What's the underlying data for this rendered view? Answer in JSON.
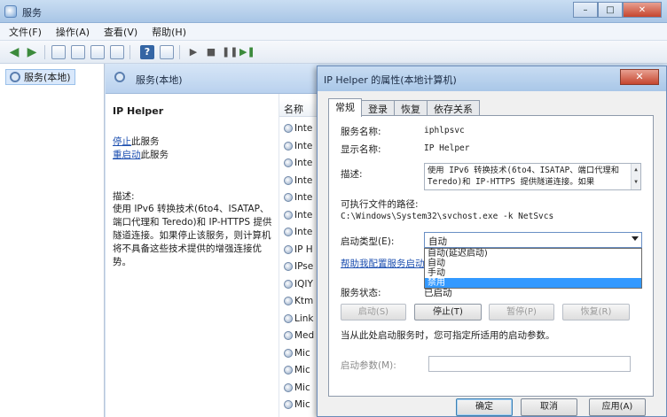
{
  "window": {
    "title": "服务",
    "minimize": "–",
    "maximize": "□",
    "close": "✕"
  },
  "menu": [
    "文件(F)",
    "操作(A)",
    "查看(V)",
    "帮助(H)"
  ],
  "toolbar": {
    "help_glyph": "?"
  },
  "tree": {
    "root_label": "服务(本地)"
  },
  "panel": {
    "header_title": "服务(本地)",
    "service_name": "IP Helper",
    "stop_link": "停止",
    "stop_suffix": "此服务",
    "restart_link": "重启动",
    "restart_suffix": "此服务",
    "desc_label": "描述:",
    "desc_text": "使用 IPv6 转换技术(6to4、ISATAP、端口代理和 Teredo)和 IP-HTTPS 提供隧道连接。如果停止该服务，则计算机将不具备这些技术提供的增强连接优势。"
  },
  "list": {
    "column_name": "名称",
    "rows": [
      "Inte",
      "Inte",
      "Inte",
      "Inte",
      "Inte",
      "Inte",
      "Inte",
      "IP H",
      "IPse",
      "IQIY",
      "Ktm",
      "Link",
      "Med",
      "Mic",
      "Mic",
      "Mic",
      "Mic"
    ]
  },
  "dialog": {
    "title": "IP Helper 的属性(本地计算机)",
    "close": "✕",
    "tabs": [
      "常规",
      "登录",
      "恢复",
      "依存关系"
    ],
    "service_name_label": "服务名称:",
    "service_name_value": "iphlpsvc",
    "display_name_label": "显示名称:",
    "display_name_value": "IP Helper",
    "description_label": "描述:",
    "description_value": "使用 IPv6 转换技术(6to4、ISATAP、端口代理和 Teredo)和 IP-HTTPS 提供隧道连接。如果",
    "exe_path_label": "可执行文件的路径:",
    "exe_path_value": "C:\\Windows\\System32\\svchost.exe -k NetSvcs",
    "startup_type_label": "启动类型(E):",
    "startup_type_value": "自动",
    "startup_options": [
      "自动(延迟启动)",
      "自动",
      "手动",
      "禁用"
    ],
    "selected_option_index": 3,
    "help_link": "帮助我配置服务启动选项。",
    "status_label": "服务状态:",
    "status_value": "已启动",
    "buttons": {
      "start": "启动(S)",
      "stop": "停止(T)",
      "pause": "暂停(P)",
      "resume": "恢复(R)"
    },
    "start_params_hint": "当从此处启动服务时，您可指定所适用的启动参数。",
    "start_params_label": "启动参数(M):",
    "start_params_value": "",
    "ok": "确定",
    "cancel": "取消",
    "apply": "应用(A)"
  }
}
